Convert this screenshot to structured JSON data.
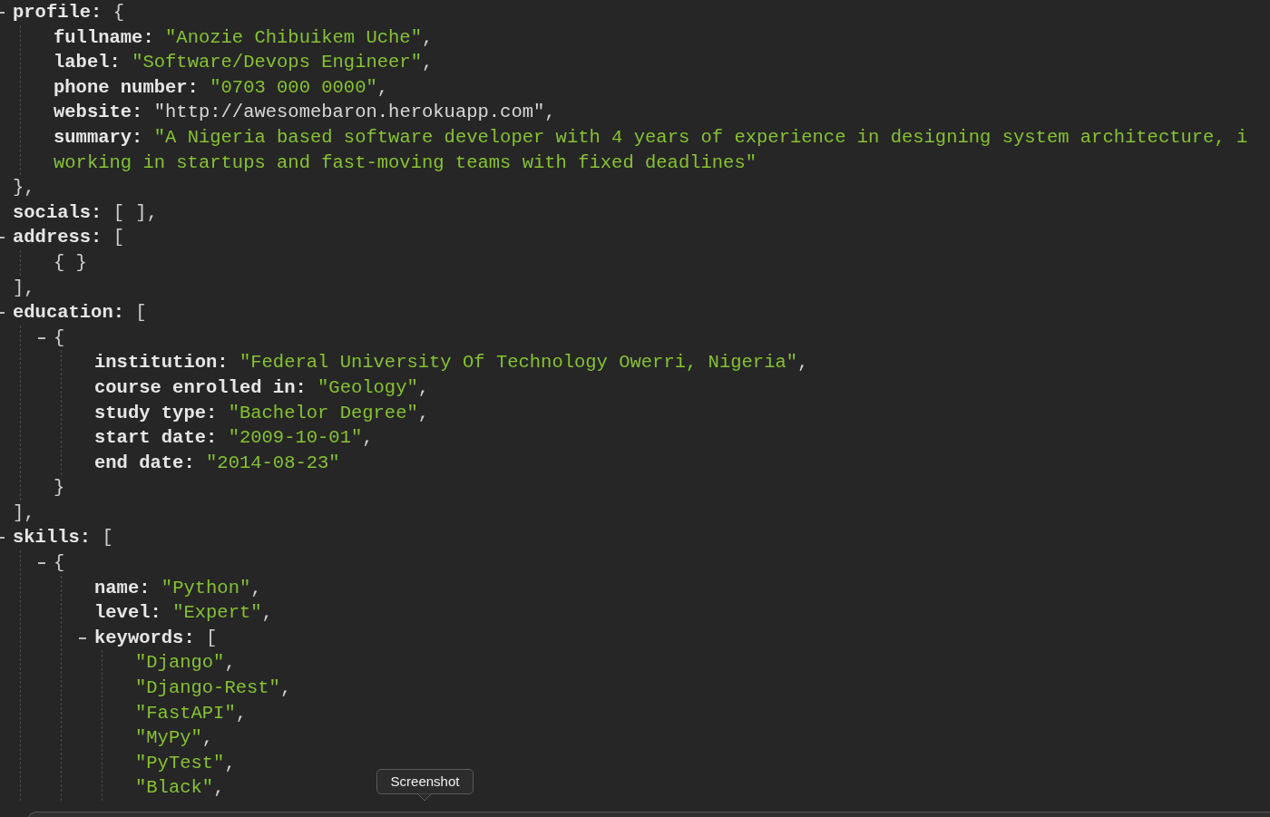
{
  "tree": [
    {
      "key": "profile:",
      "open": "{",
      "expanded": true,
      "children": [
        {
          "key": "fullname:",
          "value": "\"Anozie Chibuikem Uche\"",
          "kind": "string",
          "tail": ","
        },
        {
          "key": "label:",
          "value": "\"Software/Devops Engineer\"",
          "kind": "string",
          "tail": ","
        },
        {
          "key": "phone number:",
          "value": "\"0703 000 0000\"",
          "kind": "string",
          "tail": ","
        },
        {
          "key": "website:",
          "value": "\"http://awesomebaron.herokuapp.com\"",
          "kind": "link",
          "tail": ","
        },
        {
          "key": "summary:",
          "value_lines": [
            "\"A Nigeria based software developer with 4 years of experience in designing system architecture, i",
            "working in startups and fast-moving teams with fixed deadlines\""
          ],
          "kind": "string"
        }
      ],
      "close": "},"
    },
    {
      "key": "socials:",
      "value": "[ ]",
      "kind": "punct",
      "tail": ","
    },
    {
      "key": "address:",
      "open": "[",
      "expanded": true,
      "children": [
        {
          "value": "{ }",
          "kind": "punct"
        }
      ],
      "close": "],"
    },
    {
      "key": "education:",
      "open": "[",
      "expanded": true,
      "children": [
        {
          "open": "{",
          "expanded": true,
          "children": [
            {
              "key": "institution:",
              "value": "\"Federal University Of Technology Owerri, Nigeria\"",
              "kind": "string",
              "tail": ","
            },
            {
              "key": "course enrolled in:",
              "value": "\"Geology\"",
              "kind": "string",
              "tail": ","
            },
            {
              "key": "study type:",
              "value": "\"Bachelor Degree\"",
              "kind": "string",
              "tail": ","
            },
            {
              "key": "start date:",
              "value": "\"2009-10-01\"",
              "kind": "string",
              "tail": ","
            },
            {
              "key": "end date:",
              "value": "\"2014-08-23\"",
              "kind": "string"
            }
          ],
          "close": "}"
        }
      ],
      "close": "],"
    },
    {
      "key": "skills:",
      "open": "[",
      "expanded": true,
      "children": [
        {
          "open": "{",
          "expanded": true,
          "children": [
            {
              "key": "name:",
              "value": "\"Python\"",
              "kind": "string",
              "tail": ","
            },
            {
              "key": "level:",
              "value": "\"Expert\"",
              "kind": "string",
              "tail": ","
            },
            {
              "key": "keywords:",
              "open": "[",
              "expanded": true,
              "children": [
                {
                  "value": "\"Django\"",
                  "kind": "string",
                  "tail": ","
                },
                {
                  "value": "\"Django-Rest\"",
                  "kind": "string",
                  "tail": ","
                },
                {
                  "value": "\"FastAPI\"",
                  "kind": "string",
                  "tail": ","
                },
                {
                  "value": "\"MyPy\"",
                  "kind": "string",
                  "tail": ","
                },
                {
                  "value": "\"PyTest\"",
                  "kind": "string",
                  "tail": ","
                },
                {
                  "value": "\"Black\"",
                  "kind": "string",
                  "tail": ","
                }
              ]
            }
          ]
        }
      ]
    }
  ],
  "tooltip": {
    "text": "Screenshot"
  }
}
